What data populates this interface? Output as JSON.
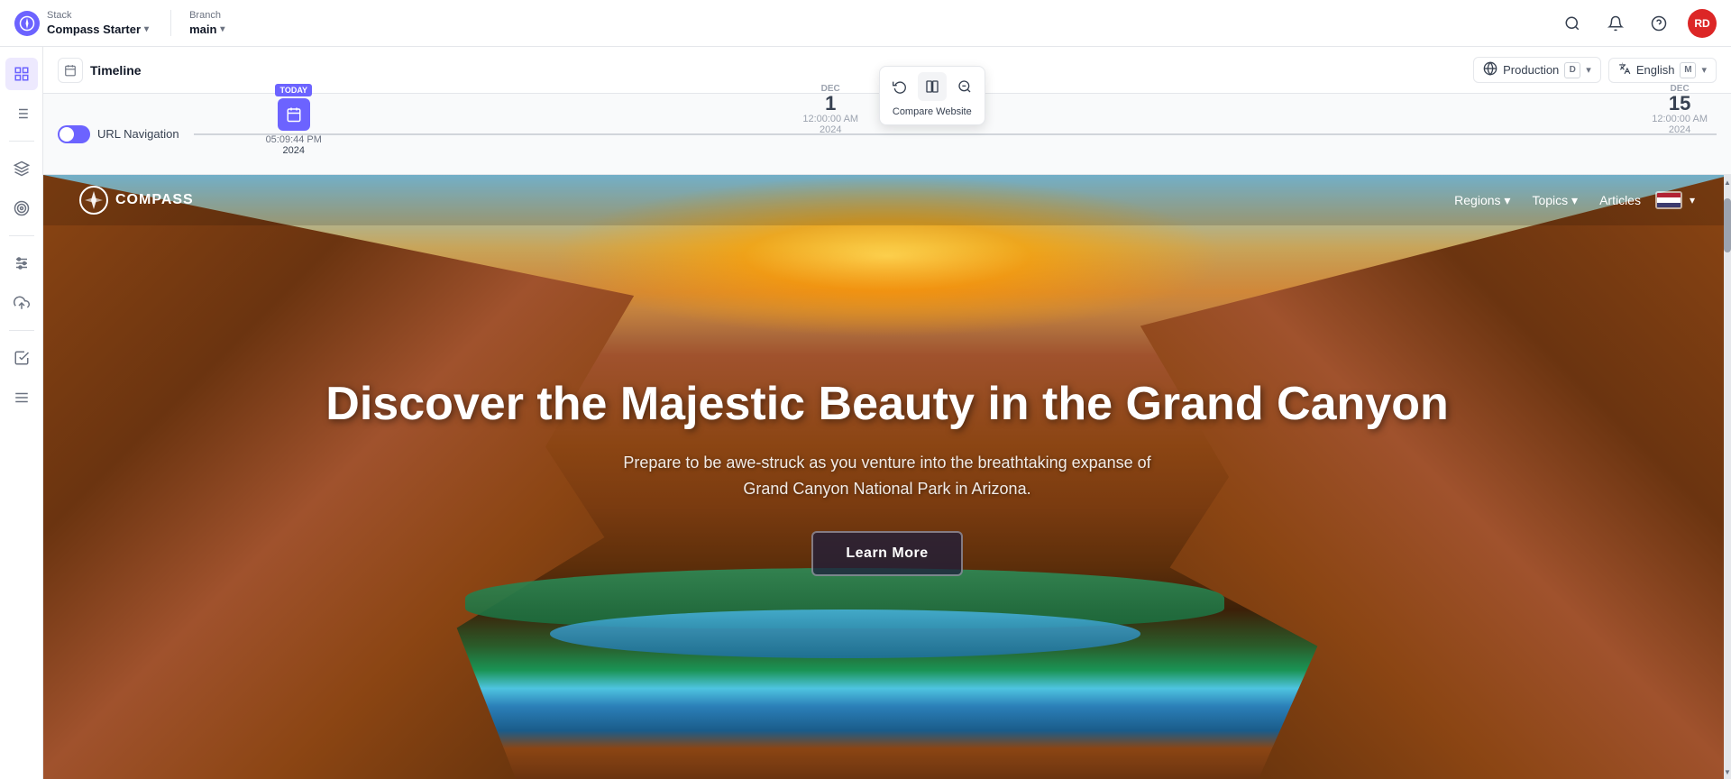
{
  "topbar": {
    "brand": {
      "stack_label": "Stack",
      "stack_name": "Compass Starter",
      "chevron": "▾"
    },
    "branch": {
      "label": "Branch",
      "name": "main",
      "chevron": "▾"
    },
    "icons": {
      "search": "🔍",
      "bell": "🔔",
      "help": "❓"
    },
    "avatar": "RD"
  },
  "timeline": {
    "title": "Timeline",
    "env": {
      "label": "Production",
      "key": "D",
      "chevron": "▾"
    },
    "lang": {
      "label": "English",
      "key": "M",
      "chevron": "▾"
    }
  },
  "track": {
    "toggle_label": "URL Navigation",
    "today_badge": "TODAY",
    "today_date": "05:09:44 PM",
    "today_year": "2024",
    "dec1_label": "DEC",
    "dec1_date": "1",
    "dec1_time": "12:00:00 AM",
    "dec1_year": "2024",
    "dec15_label": "DEC",
    "dec15_date": "15",
    "dec15_time": "12:00:00 AM",
    "dec15_year": "2024"
  },
  "toolbar_popup": {
    "label": "Compare Website",
    "buttons": [
      {
        "icon": "↺",
        "name": "undo-btn"
      },
      {
        "icon": "⊞",
        "name": "compare-btn"
      },
      {
        "icon": "⊖",
        "name": "minus-btn"
      }
    ]
  },
  "preview": {
    "nav": {
      "logo_text": "COMPASS",
      "links": [
        "Regions ▾",
        "Topics ▾",
        "Articles"
      ]
    },
    "hero": {
      "title": "Discover the Majestic Beauty in the Grand Canyon",
      "subtitle": "Prepare to be awe-struck as you venture into the breathtaking expanse of Grand Canyon National Park in Arizona.",
      "cta": "Learn More"
    }
  },
  "sidebar": {
    "items": [
      {
        "icon": "⊞",
        "name": "grid-icon",
        "active": false
      },
      {
        "icon": "☰",
        "name": "list-icon",
        "active": false
      },
      {
        "icon": "⊕",
        "name": "plus-icon",
        "active": false
      },
      {
        "icon": "◉",
        "name": "target-icon",
        "active": false
      },
      {
        "icon": "≡",
        "name": "layers-icon",
        "active": false
      },
      {
        "icon": "↑",
        "name": "upload-icon",
        "active": false
      },
      {
        "icon": "☑",
        "name": "check-icon",
        "active": false
      },
      {
        "icon": "⊛",
        "name": "star-icon",
        "active": false
      }
    ]
  }
}
